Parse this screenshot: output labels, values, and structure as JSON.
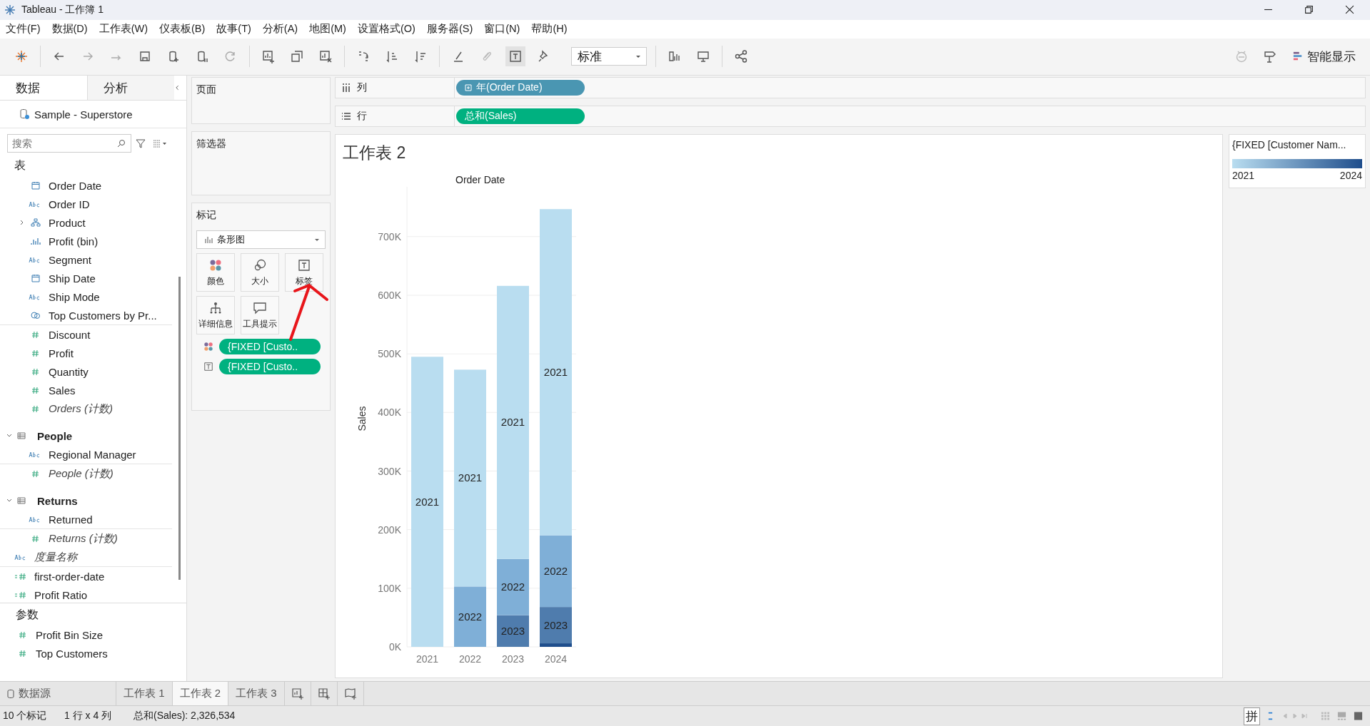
{
  "window": {
    "title": "Tableau - 工作簿 1"
  },
  "menu": [
    "文件(F)",
    "数据(D)",
    "工作表(W)",
    "仪表板(B)",
    "故事(T)",
    "分析(A)",
    "地图(M)",
    "设置格式(O)",
    "服务器(S)",
    "窗口(N)",
    "帮助(H)"
  ],
  "toolbar": {
    "fit_dropdown": "标准",
    "show_me": "智能显示"
  },
  "data_pane": {
    "tabs": [
      {
        "label": "数据",
        "selected": true
      },
      {
        "label": "分析",
        "selected": false
      }
    ],
    "datasource": "Sample - Superstore",
    "search": {
      "placeholder": "搜索"
    },
    "sections": [
      {
        "title": "表",
        "kind": "root",
        "items": [
          {
            "name": "Order Date",
            "kind": "date"
          },
          {
            "name": "Order ID",
            "kind": "string"
          },
          {
            "name": "Product",
            "kind": "hierarchy",
            "expanded": false
          },
          {
            "name": "Profit (bin)",
            "kind": "bin"
          },
          {
            "name": "Segment",
            "kind": "string"
          },
          {
            "name": "Ship Date",
            "kind": "date"
          },
          {
            "name": "Ship Mode",
            "kind": "string"
          },
          {
            "name": "Top Customers by Pr...",
            "kind": "set"
          },
          {
            "name": "Discount",
            "kind": "measure"
          },
          {
            "name": "Profit",
            "kind": "measure"
          },
          {
            "name": "Quantity",
            "kind": "measure"
          },
          {
            "name": "Sales",
            "kind": "measure"
          },
          {
            "name": "Orders (计数)",
            "kind": "measure",
            "italic": true
          }
        ]
      },
      {
        "title": "People",
        "kind": "table",
        "expanded": true,
        "items": [
          {
            "name": "Regional Manager",
            "kind": "string"
          },
          {
            "name": "People (计数)",
            "kind": "measure",
            "italic": true
          }
        ]
      },
      {
        "title": "Returns",
        "kind": "table",
        "expanded": true,
        "items": [
          {
            "name": "Returned",
            "kind": "string"
          },
          {
            "name": "Returns (计数)",
            "kind": "measure",
            "italic": true
          }
        ]
      },
      {
        "kind": "loose",
        "items": [
          {
            "name": "度量名称",
            "kind": "string",
            "italic": true
          },
          {
            "name": "first-order-date",
            "kind": "calc"
          },
          {
            "name": "Profit Ratio",
            "kind": "calc"
          }
        ]
      }
    ],
    "parameters": {
      "title": "参数",
      "items": [
        {
          "name": "Profit Bin Size",
          "kind": "measure"
        },
        {
          "name": "Top Customers",
          "kind": "measure"
        }
      ]
    }
  },
  "cards": {
    "pages": "页面",
    "filters": "筛选器",
    "marks": {
      "title": "标记",
      "mark_type": "条形图",
      "buttons": [
        {
          "label": "颜色",
          "kind": "color"
        },
        {
          "label": "大小",
          "kind": "size"
        },
        {
          "label": "标签",
          "kind": "label"
        },
        {
          "label": "详细信息",
          "kind": "detail"
        },
        {
          "label": "工具提示",
          "kind": "tooltip"
        }
      ],
      "pills": [
        {
          "kind": "color",
          "label": "{FIXED [Custo.."
        },
        {
          "kind": "label",
          "label": "{FIXED [Custo.."
        }
      ]
    }
  },
  "shelves": [
    {
      "kind": "columns",
      "label": "列",
      "pill": "年(Order Date)",
      "discrete": true
    },
    {
      "kind": "rows",
      "label": "行",
      "pill": "总和(Sales)",
      "discrete": false
    }
  ],
  "view": {
    "title": "工作表 2",
    "segment_labels": true,
    "chart_data": {
      "type": "bar",
      "stacked": true,
      "grid": true,
      "xlabel": "Order Date",
      "ylabel": "Sales",
      "categories": [
        "2021",
        "2022",
        "2023",
        "2024"
      ],
      "series": [
        {
          "name": "2024",
          "color": "#1f4e8c",
          "values": [
            null,
            null,
            null,
            6000
          ]
        },
        {
          "name": "2023",
          "color": "#4f7cad",
          "values": [
            null,
            null,
            54000,
            62000
          ]
        },
        {
          "name": "2022",
          "color": "#7fafd7",
          "values": [
            null,
            103000,
            96000,
            122000
          ]
        },
        {
          "name": "2021",
          "color": "#b9ddf0",
          "values": [
            495000,
            370000,
            466000,
            557000
          ]
        }
      ],
      "ylim": [
        0,
        785000
      ],
      "yticks": [
        {
          "value": 0,
          "label": "0K"
        },
        {
          "value": 100000,
          "label": "100K"
        },
        {
          "value": 200000,
          "label": "200K"
        },
        {
          "value": 300000,
          "label": "300K"
        },
        {
          "value": 400000,
          "label": "400K"
        },
        {
          "value": 500000,
          "label": "500K"
        },
        {
          "value": 600000,
          "label": "600K"
        },
        {
          "value": 700000,
          "label": "700K"
        }
      ]
    }
  },
  "legend": {
    "title": "{FIXED [Customer Nam..."
  },
  "sheet_tabs": [
    {
      "label": "数据源",
      "kind": "datasource",
      "selected": false
    },
    {
      "label": "工作表 1",
      "kind": "sheet",
      "selected": false
    },
    {
      "label": "工作表 2",
      "kind": "sheet",
      "selected": true
    },
    {
      "label": "工作表 3",
      "kind": "sheet",
      "selected": false
    }
  ],
  "status": {
    "items": [
      "10 个标记",
      "1 行 x 4 列",
      "总和(Sales): 2,326,534"
    ],
    "ime": "拼"
  }
}
